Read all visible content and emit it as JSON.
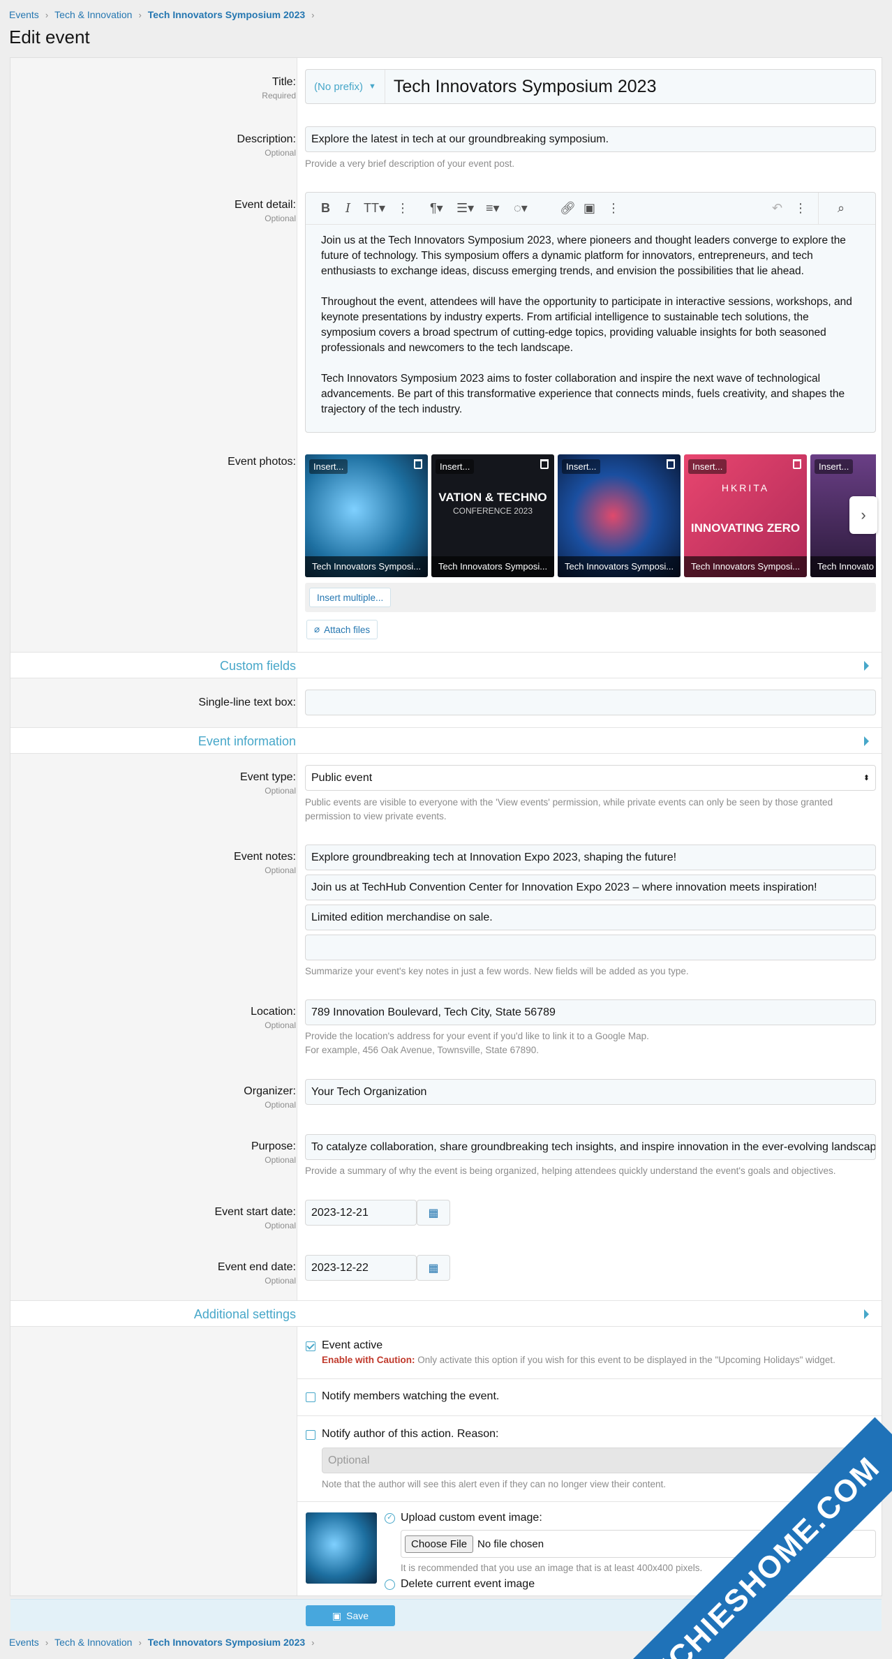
{
  "breadcrumb": {
    "items": [
      "Events",
      "Tech & Innovation"
    ],
    "current": "Tech Innovators Symposium 2023"
  },
  "page": {
    "title": "Edit event"
  },
  "fields": {
    "title": {
      "label": "Title:",
      "hint": "Required",
      "prefix": "(No prefix)",
      "value": "Tech Innovators Symposium 2023"
    },
    "description": {
      "label": "Description:",
      "hint": "Optional",
      "value": "Explore the latest in tech at our groundbreaking symposium.",
      "explain": "Provide a very brief description of your event post."
    },
    "event_detail": {
      "label": "Event detail:",
      "hint": "Optional",
      "paragraphs": [
        "Join us at the Tech Innovators Symposium 2023, where pioneers and thought leaders converge to explore the future of technology. This symposium offers a dynamic platform for innovators, entrepreneurs, and tech enthusiasts to exchange ideas, discuss emerging trends, and envision the possibilities that lie ahead.",
        "Throughout the event, attendees will have the opportunity to participate in interactive sessions, workshops, and keynote presentations by industry experts. From artificial intelligence to sustainable tech solutions, the symposium covers a broad spectrum of cutting-edge topics, providing valuable insights for both seasoned professionals and newcomers to the tech landscape.",
        "Tech Innovators Symposium 2023 aims to foster collaboration and inspire the next wave of technological advancements. Be part of this transformative experience that connects minds, fuels creativity, and shapes the trajectory of the tech industry."
      ]
    },
    "event_photos": {
      "label": "Event photos:",
      "insert_label": "Insert...",
      "thumbs": [
        {
          "caption": "Tech Innovators Symposi...",
          "color": "#1d6fa0"
        },
        {
          "caption": "Tech Innovators Symposi...",
          "color": "#14161c",
          "overlay": "VATION & TECHNO",
          "overlay2": "CONFERENCE 2023"
        },
        {
          "caption": "Tech Innovators Symposi...",
          "color": "#0f2a55"
        },
        {
          "caption": "Tech Innovators Symposi...",
          "color": "#d43a66",
          "overlay": "HKRITA",
          "overlay2": "INNOVATING ZERO"
        },
        {
          "caption": "Tech Innovato",
          "color": "#4a2b63"
        }
      ]
    },
    "insert_multiple": "Insert multiple...",
    "attach_files": "Attach files"
  },
  "sections": {
    "custom": "Custom fields",
    "event_info": "Event information",
    "additional": "Additional settings"
  },
  "custom": {
    "single_line": {
      "label": "Single-line text box:",
      "value": ""
    }
  },
  "event_info": {
    "type": {
      "label": "Event type:",
      "hint": "Optional",
      "value": "Public event",
      "explain": "Public events are visible to everyone with the 'View events' permission, while private events can only be seen by those granted permission to view private events."
    },
    "notes": {
      "label": "Event notes:",
      "hint": "Optional",
      "values": [
        "Explore groundbreaking tech at Innovation Expo 2023, shaping the future!",
        "Join us at TechHub Convention Center for Innovation Expo 2023 – where innovation meets inspiration!",
        "Limited edition merchandise on sale.",
        ""
      ],
      "explain": "Summarize your event's key notes in just a few words. New fields will be added as you type."
    },
    "location": {
      "label": "Location:",
      "hint": "Optional",
      "value": "789 Innovation Boulevard, Tech City, State 56789",
      "explain1": "Provide the location's address for your event if you'd like to link it to a Google Map.",
      "explain2": "For example, 456 Oak Avenue, Townsville, State 67890."
    },
    "organizer": {
      "label": "Organizer:",
      "hint": "Optional",
      "value": "Your Tech Organization"
    },
    "purpose": {
      "label": "Purpose:",
      "hint": "Optional",
      "value": "To catalyze collaboration, share groundbreaking tech insights, and inspire innovation in the ever-evolving landscape",
      "explain": "Provide a summary of why the event is being organized, helping attendees quickly understand the event's goals and objectives."
    },
    "start_date": {
      "label": "Event start date:",
      "hint": "Optional",
      "value": "2023-12-21"
    },
    "end_date": {
      "label": "Event end date:",
      "hint": "Optional",
      "value": "2023-12-22"
    }
  },
  "additional": {
    "active": {
      "label": "Event active",
      "caution": "Enable with Caution:",
      "explain": "Only activate this option if you wish for this event to be displayed in the \"Upcoming Holidays\" widget."
    },
    "notify_watch": {
      "label": "Notify members watching the event."
    },
    "notify_author": {
      "label": "Notify author of this action. Reason:",
      "placeholder": "Optional",
      "explain": "Note that the author will see this alert even if they can no longer view their content."
    },
    "upload": {
      "label": "Upload custom event image:",
      "choose": "Choose File",
      "nofile": "No file chosen",
      "explain": "It is recommended that you use an image that is at least 400x400 pixels."
    },
    "delete": {
      "label": "Delete current event image"
    }
  },
  "save": "Save",
  "watermark": "TECHIESHOME.COM",
  "colors": {
    "accent": "#47a7c9",
    "link": "#2577b1",
    "caution": "#c0392b"
  }
}
